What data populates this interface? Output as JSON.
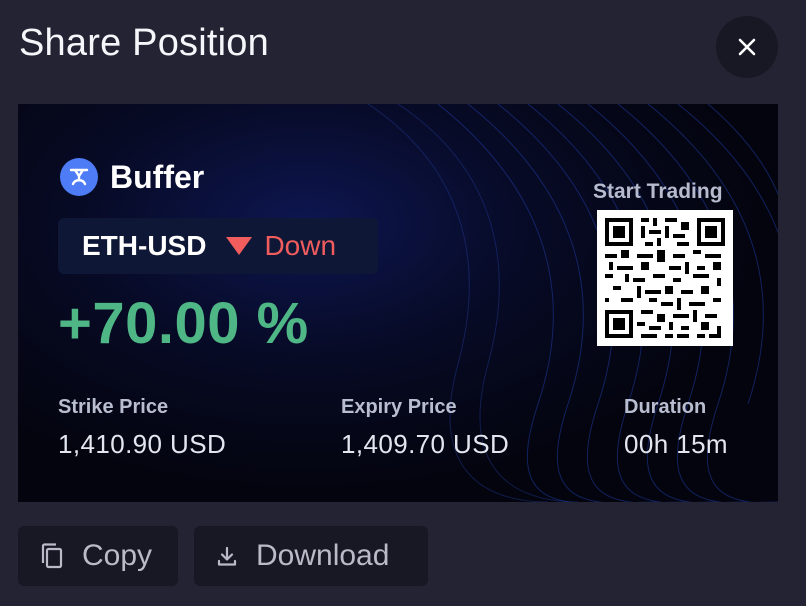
{
  "dialog": {
    "title": "Share Position",
    "close_icon": "close-icon"
  },
  "card": {
    "brand": {
      "name": "Buffer",
      "logo_icon": "buffer-logo-icon",
      "logo_color": "#4d7cf6"
    },
    "pair": "ETH-USD",
    "direction": {
      "label": "Down",
      "icon": "triangle-down-icon",
      "color": "#f15d5d"
    },
    "pnl": "+70.00 %",
    "pnl_color": "#4fb785",
    "stats": [
      {
        "label": "Strike Price",
        "value": "1,410.90 USD"
      },
      {
        "label": "Expiry Price",
        "value": "1,409.70 USD"
      },
      {
        "label": "Duration",
        "value": "00h 15m"
      }
    ],
    "cta": "Start Trading",
    "qr_icon": "qr-code-icon"
  },
  "actions": {
    "copy": {
      "label": "Copy",
      "icon": "copy-icon"
    },
    "download": {
      "label": "Download",
      "icon": "download-icon"
    }
  }
}
